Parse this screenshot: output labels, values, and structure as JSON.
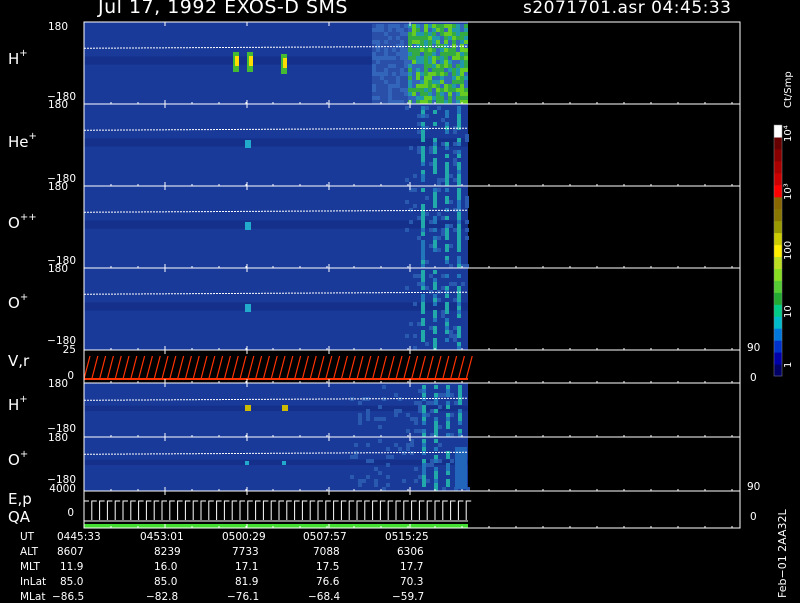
{
  "header": {
    "title": "Jul 17, 1992    EXOS-D SMS",
    "file_time": "s2071701.asr  04:45:33"
  },
  "colorbar": {
    "unit_label": "Ct/Smp",
    "tick_labels": [
      "1",
      "10",
      "100",
      "10³",
      "10⁴"
    ],
    "colors": [
      "#000066",
      "#0000aa",
      "#0033cc",
      "#0077dd",
      "#00bbcc",
      "#00cc88",
      "#22aa33",
      "#55cc33",
      "#88dd22",
      "#bbdd22",
      "#ffee00",
      "#cccc00",
      "#999900",
      "#887700",
      "#886600",
      "#ff0000",
      "#cc0000",
      "#aa0000",
      "#880000",
      "#660000",
      "#ffffff"
    ]
  },
  "panels": [
    {
      "id": "h-plus",
      "species": "H",
      "charge": "+",
      "ymax": "180",
      "ymin": "−180"
    },
    {
      "id": "he-plus",
      "species": "He",
      "charge": "+",
      "ymax": "180",
      "ymin": "−180"
    },
    {
      "id": "o-plusplus",
      "species": "O",
      "charge": "++",
      "ymax": "180",
      "ymin": "−180"
    },
    {
      "id": "o-plus",
      "species": "O",
      "charge": "+",
      "ymax": "180",
      "ymin": "−180"
    },
    {
      "id": "vr",
      "label": "V,r",
      "ymax": "25",
      "ymin": "0",
      "rmax": "90",
      "rmin": "0"
    },
    {
      "id": "h-plus-2",
      "species": "H",
      "charge": "+",
      "ymax": "180",
      "ymin": "−180"
    },
    {
      "id": "o-plus-2",
      "species": "O",
      "charge": "+",
      "ymax": "180",
      "ymin": "−180"
    },
    {
      "id": "ep-qa",
      "label": "E,p",
      "label2": "QA",
      "ymax": "4000",
      "ymin": "0",
      "rmax": "90",
      "rmin": "0"
    }
  ],
  "footer": {
    "row_labels": [
      "UT",
      "ALT",
      "MLT",
      "InLat",
      "MLat"
    ],
    "columns": [
      [
        "0445:33",
        "8607",
        "11.9",
        "85.0",
        "−86.5"
      ],
      [
        "0453:01",
        "8239",
        "16.0",
        "85.0",
        "−82.8"
      ],
      [
        "0500:29",
        "7733",
        "17.1",
        "81.9",
        "−76.1"
      ],
      [
        "0507:57",
        "7088",
        "17.5",
        "76.6",
        "−68.4"
      ],
      [
        "0515:25",
        "6306",
        "17.7",
        "70.3",
        "−59.7"
      ]
    ],
    "side_stamp": "Feb−01 2AA32L"
  },
  "chart_data": {
    "type": "heatmap",
    "title": "Jul 17, 1992    EXOS-D SMS",
    "x_tick_labels": [
      "0445:33",
      "0453:01",
      "0500:29",
      "0507:57",
      "0515:25"
    ],
    "series": [
      {
        "name": "H+",
        "ylim": [
          -180,
          180
        ]
      },
      {
        "name": "He+",
        "ylim": [
          -180,
          180
        ]
      },
      {
        "name": "O++",
        "ylim": [
          -180,
          180
        ]
      },
      {
        "name": "O+",
        "ylim": [
          -180,
          180
        ]
      },
      {
        "name": "V,r",
        "ylim": [
          0,
          25
        ]
      },
      {
        "name": "H+",
        "ylim": [
          -180,
          180
        ]
      },
      {
        "name": "O+",
        "ylim": [
          -180,
          180
        ]
      },
      {
        "name": "E,p QA",
        "ylim": [
          0,
          4000
        ]
      }
    ],
    "colorbar_scale": "log",
    "colorbar_range": [
      1,
      10000
    ]
  }
}
